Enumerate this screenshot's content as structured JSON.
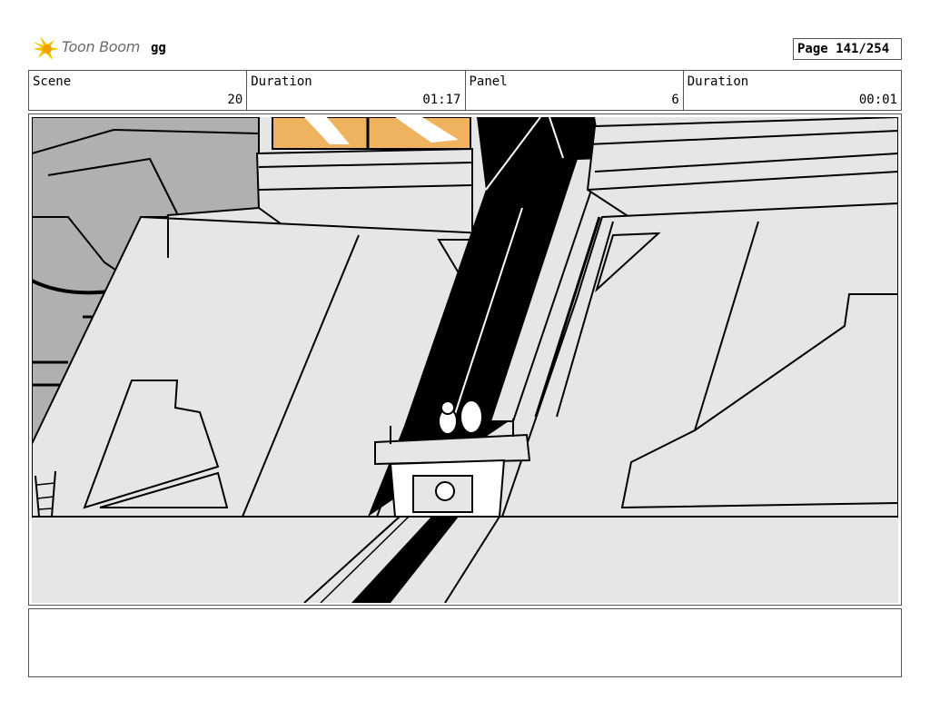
{
  "header": {
    "logo_text": "Toon Boom",
    "project_name": "gg",
    "page_label": "Page 141/254"
  },
  "info": {
    "scene_label": "Scene",
    "scene_value": "20",
    "scene_duration_label": "Duration",
    "scene_duration_value": "01:17",
    "panel_label": "Panel",
    "panel_value": "6",
    "panel_duration_label": "Duration",
    "panel_duration_value": "00:01"
  },
  "colors": {
    "accent_yellow": "#f5c400",
    "orange_stripe": "#efb35f",
    "wall_fill": "#e6e6e6",
    "background_gray": "#b0b0b0"
  }
}
